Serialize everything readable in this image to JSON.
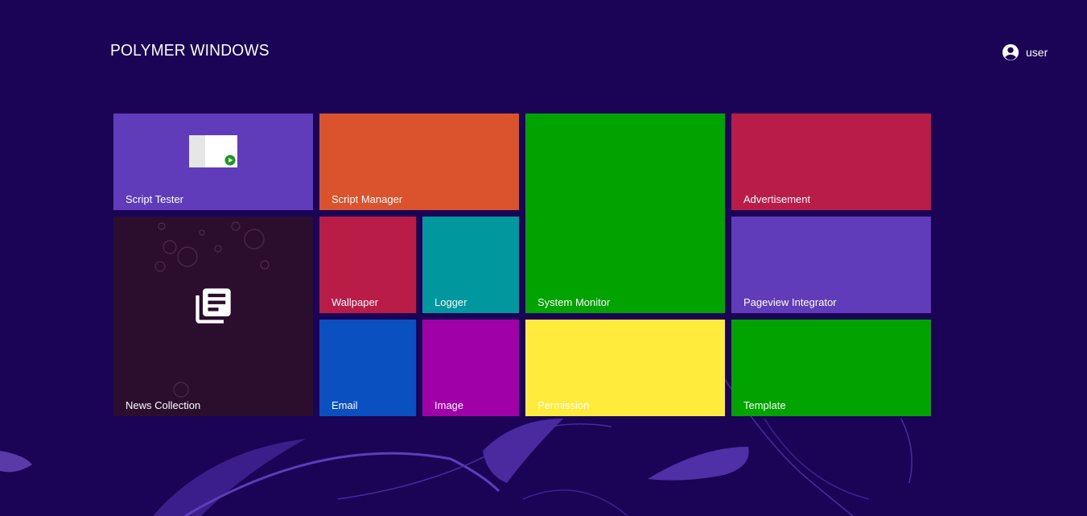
{
  "app": {
    "title": "POLYMER WINDOWS"
  },
  "user": {
    "name": "user",
    "icon": "account-circle-icon"
  },
  "colors": {
    "background": "#1b0456",
    "purple": "#603cba",
    "orange": "#da532c",
    "green": "#00a300",
    "crimson": "#b91d47",
    "dark": "#2b0d2e",
    "teal": "#00979f",
    "blue": "#0b50c0",
    "magenta": "#9f00a7",
    "yellow": "#ffeb3b"
  },
  "tiles": [
    {
      "id": "script-tester",
      "label": "Script Tester",
      "color": "#603cba",
      "icon": "script-preview-icon"
    },
    {
      "id": "script-manager",
      "label": "Script Manager",
      "color": "#da532c"
    },
    {
      "id": "system-monitor",
      "label": "System Monitor",
      "color": "#00a300"
    },
    {
      "id": "advertisement",
      "label": "Advertisement",
      "color": "#b91d47"
    },
    {
      "id": "news-collection",
      "label": "News Collection",
      "color": "#2b0d2e",
      "icon": "library-books-icon"
    },
    {
      "id": "wallpaper",
      "label": "Wallpaper",
      "color": "#b91d47"
    },
    {
      "id": "logger",
      "label": "Logger",
      "color": "#00979f"
    },
    {
      "id": "pageview-integrator",
      "label": "Pageview Integrator",
      "color": "#603cba"
    },
    {
      "id": "email",
      "label": "Email",
      "color": "#0b50c0"
    },
    {
      "id": "image",
      "label": "Image",
      "color": "#9f00a7"
    },
    {
      "id": "permission",
      "label": "Permission",
      "color": "#ffeb3b"
    },
    {
      "id": "template",
      "label": "Template",
      "color": "#00a300"
    }
  ]
}
